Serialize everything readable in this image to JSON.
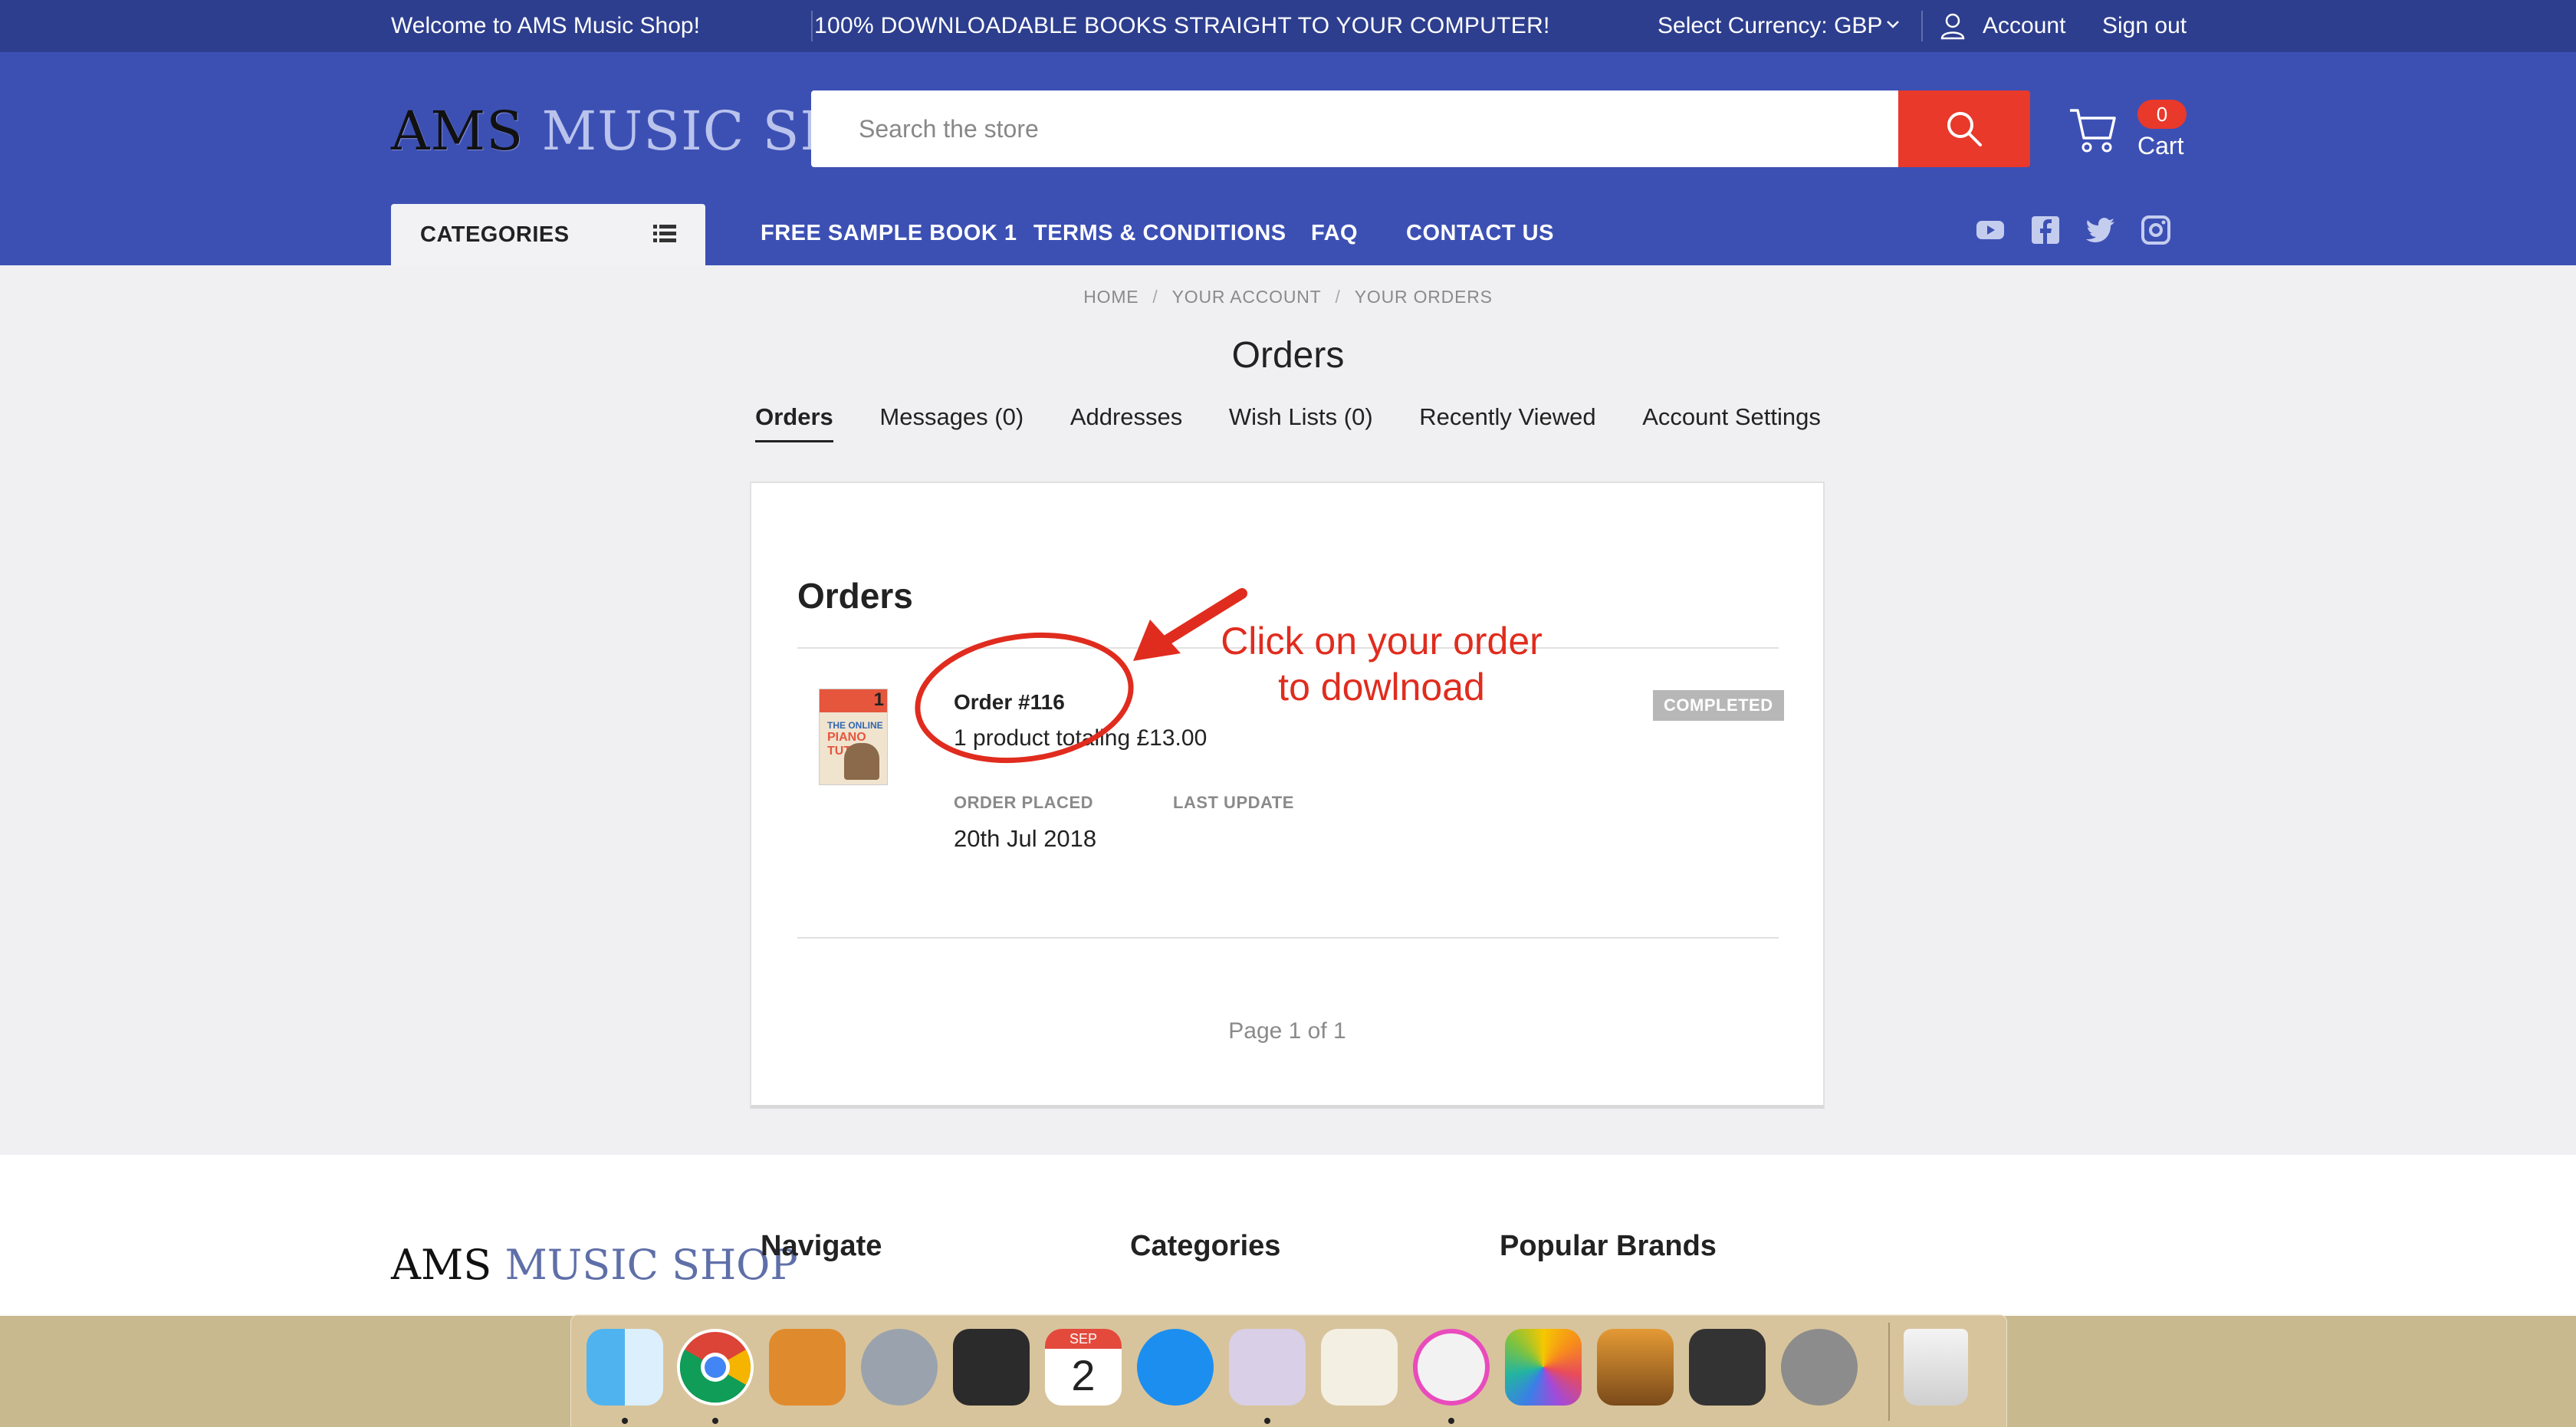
{
  "topbar": {
    "welcome": "Welcome to AMS Music Shop!",
    "promo": "100% DOWNLOADABLE BOOKS STRAIGHT TO YOUR COMPUTER!",
    "currency": "Select Currency: GBP",
    "account": "Account",
    "signout": "Sign out"
  },
  "header": {
    "logo_ams": "AMS",
    "logo_rest": "MUSIC SHOP",
    "search_placeholder": "Search the store",
    "cart_count": "0",
    "cart_label": "Cart"
  },
  "nav": {
    "categories": "CATEGORIES",
    "links": [
      "FREE SAMPLE BOOK 1",
      "TERMS & CONDITIONS",
      "FAQ",
      "CONTACT US"
    ],
    "social": [
      "youtube-icon",
      "facebook-icon",
      "twitter-icon",
      "instagram-icon"
    ]
  },
  "breadcrumbs": [
    "HOME",
    "YOUR ACCOUNT",
    "YOUR ORDERS"
  ],
  "page_title": "Orders",
  "tabs": [
    "Orders",
    "Messages (0)",
    "Addresses",
    "Wish Lists (0)",
    "Recently Viewed",
    "Account Settings"
  ],
  "orders": {
    "heading": "Orders",
    "order": {
      "number": "Order #116",
      "summary": "1 product totaling £13.00",
      "status": "COMPLETED",
      "placed_label": "ORDER PLACED",
      "placed_value": "20th Jul 2018",
      "update_label": "LAST UPDATE",
      "thumb_num": "1",
      "thumb_line1": "THE ONLINE",
      "thumb_line2": "PIANO TUTOR"
    },
    "pagination": "Page 1 of 1"
  },
  "annotation": {
    "line1": "Click on your order",
    "line2": "to dowlnoad",
    "color": "#e02c1e"
  },
  "footer": {
    "logo_ams": "AMS",
    "logo_rest": "MUSIC SHOP",
    "columns": [
      "Navigate",
      "Categories",
      "Popular Brands"
    ]
  },
  "dock": {
    "apps": [
      "finder-icon",
      "chrome-icon",
      "calculator-icon",
      "launchpad-icon",
      "final-cut-icon",
      "calendar-icon",
      "app-store-icon",
      "music-notation-icon",
      "pages-icon",
      "itunes-icon",
      "photos-icon",
      "preview-icon",
      "motion-icon",
      "system-preferences-icon",
      "trash-icon"
    ],
    "calendar_month": "SEP",
    "calendar_day": "2"
  },
  "colors": {
    "topbar": "#2d3e8e",
    "header": "#3c50b4",
    "accent": "#e8392b",
    "content_bg": "#f0f0f2"
  }
}
